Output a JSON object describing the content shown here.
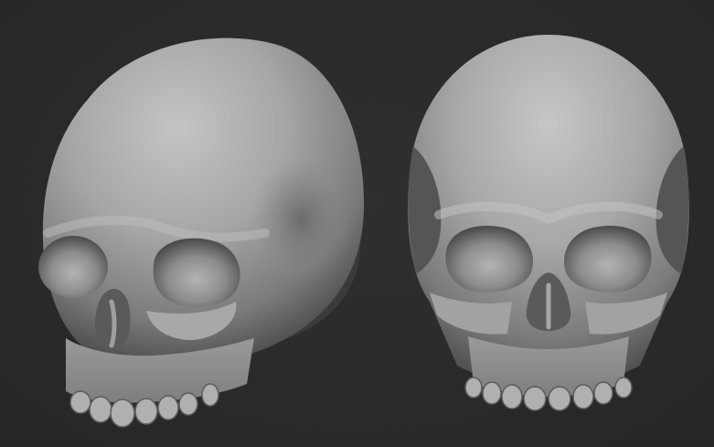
{
  "scene": {
    "background_color": "#2b2b2b",
    "material_color": "#9a9a9a",
    "views": [
      {
        "name": "skull-three-quarter-view"
      },
      {
        "name": "skull-front-view"
      }
    ]
  }
}
